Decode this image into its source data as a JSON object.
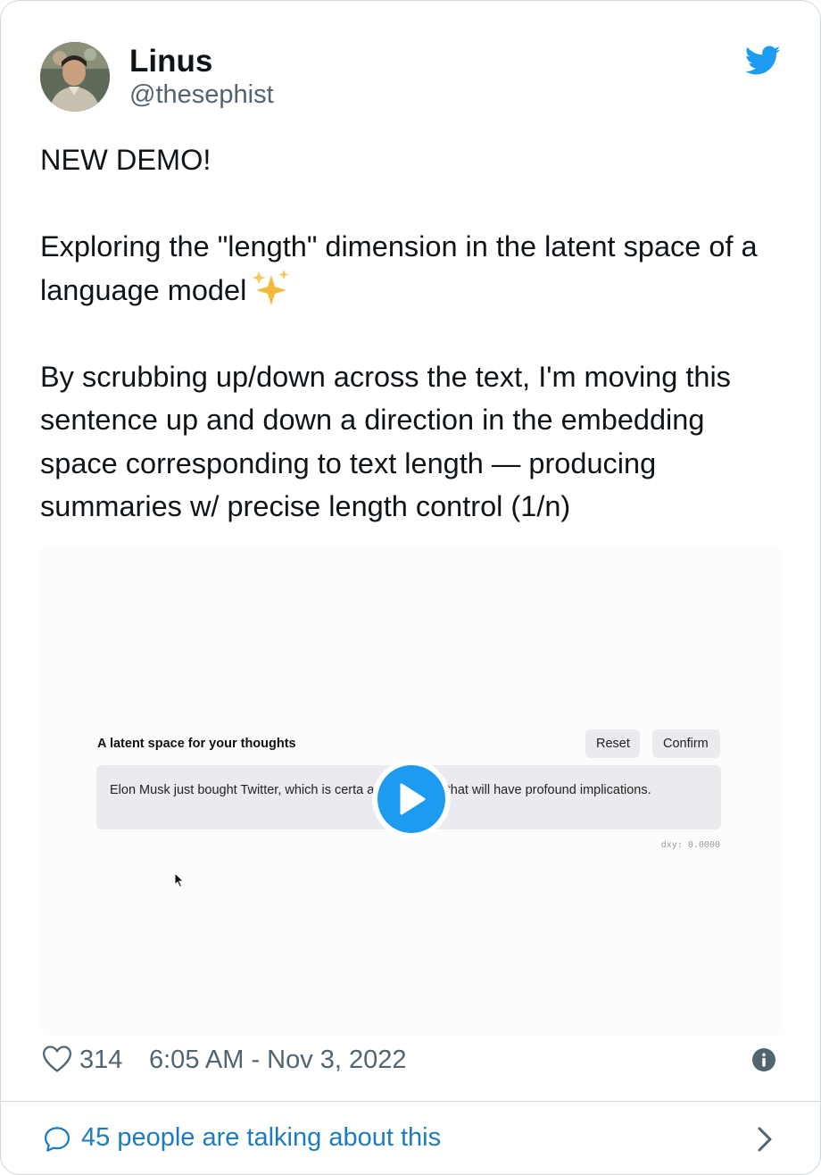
{
  "author": {
    "display_name": "Linus",
    "handle": "@thesephist"
  },
  "tweet": {
    "paragraphs": [
      "NEW DEMO!",
      "Exploring the \"length\" dimension in the latent space of a language model",
      "By scrubbing up/down across the text, I'm moving this sentence up and down a direction in the embedding space corresponding to text length — producing summaries w/ precise length control (1/n)"
    ],
    "emoji_icon": "sparkles-icon"
  },
  "media": {
    "app_title": "A latent space for your thoughts",
    "reset_label": "Reset",
    "confirm_label": "Confirm",
    "textbox_text": "Elon Musk just bought Twitter, which is certa   a d     g d  cision that will have profound implications.",
    "dxy_readout": "dxy: 0.0000"
  },
  "footer": {
    "likes": "314",
    "timestamp": "6:05 AM - Nov 3, 2022",
    "talking": "45 people are talking about this"
  },
  "colors": {
    "accent": "#1d9bf0",
    "link": "#1d7cc0",
    "muted": "#536471"
  }
}
